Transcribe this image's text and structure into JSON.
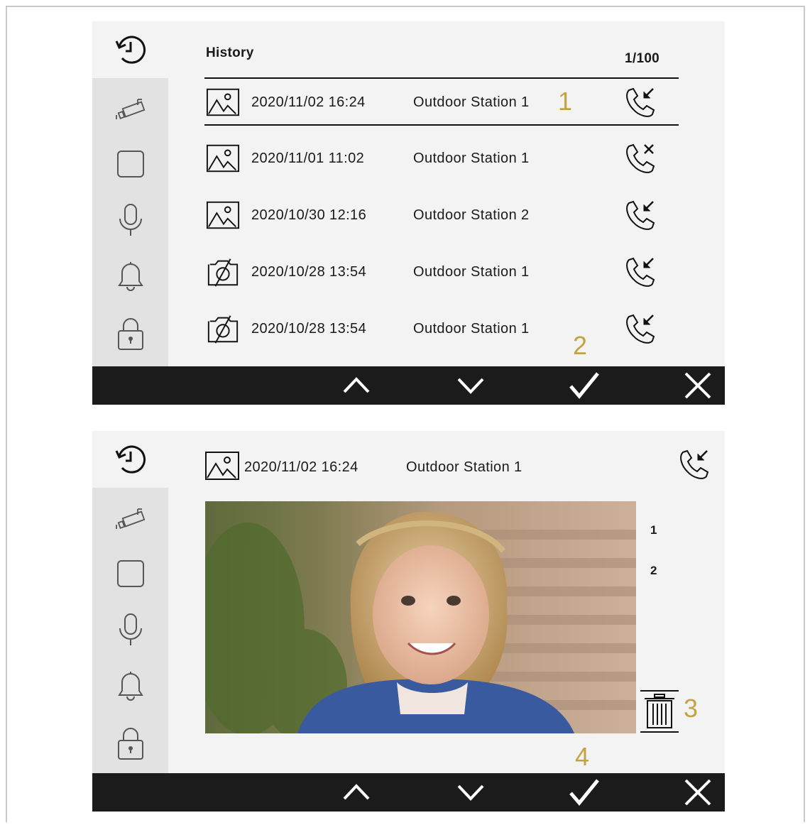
{
  "top_screen": {
    "title": "History",
    "page_indicator": "1/100",
    "rows": [
      {
        "date": "2020/11/02 16:24",
        "station": "Outdoor Station 1",
        "thumb": "image-icon",
        "call": "incoming-call-icon",
        "selected": true
      },
      {
        "date": "2020/11/01 11:02",
        "station": "Outdoor Station 1",
        "thumb": "image-icon",
        "call": "missed-call-icon",
        "selected": false
      },
      {
        "date": "2020/10/30 12:16",
        "station": "Outdoor Station 2",
        "thumb": "image-icon",
        "call": "incoming-call-icon",
        "selected": false
      },
      {
        "date": "2020/10/28 13:54",
        "station": "Outdoor Station 1",
        "thumb": "no-image-icon",
        "call": "incoming-call-icon",
        "selected": false
      },
      {
        "date": "2020/10/28 13:54",
        "station": "Outdoor Station 1",
        "thumb": "no-image-icon",
        "call": "incoming-call-icon",
        "selected": false
      }
    ],
    "markers": {
      "m1": "1",
      "m2": "2"
    }
  },
  "bottom_screen": {
    "date": "2020/11/02 16:24",
    "station": "Outdoor Station 1",
    "image_index": {
      "first": "1",
      "second": "2"
    },
    "markers": {
      "m3": "3",
      "m4": "4"
    }
  },
  "sidebar_icons": [
    "history-icon",
    "camera-icon",
    "square-icon",
    "microphone-icon",
    "bell-icon",
    "lock-icon"
  ],
  "bottom_bar_icons": [
    "up-arrow-icon",
    "down-arrow-icon",
    "confirm-check-icon",
    "close-icon"
  ],
  "colors": {
    "accent_marker": "#c4a442",
    "bar": "#1b1b1b",
    "panel": "#f3f3f3",
    "sidebar": "#e2e2e2"
  }
}
